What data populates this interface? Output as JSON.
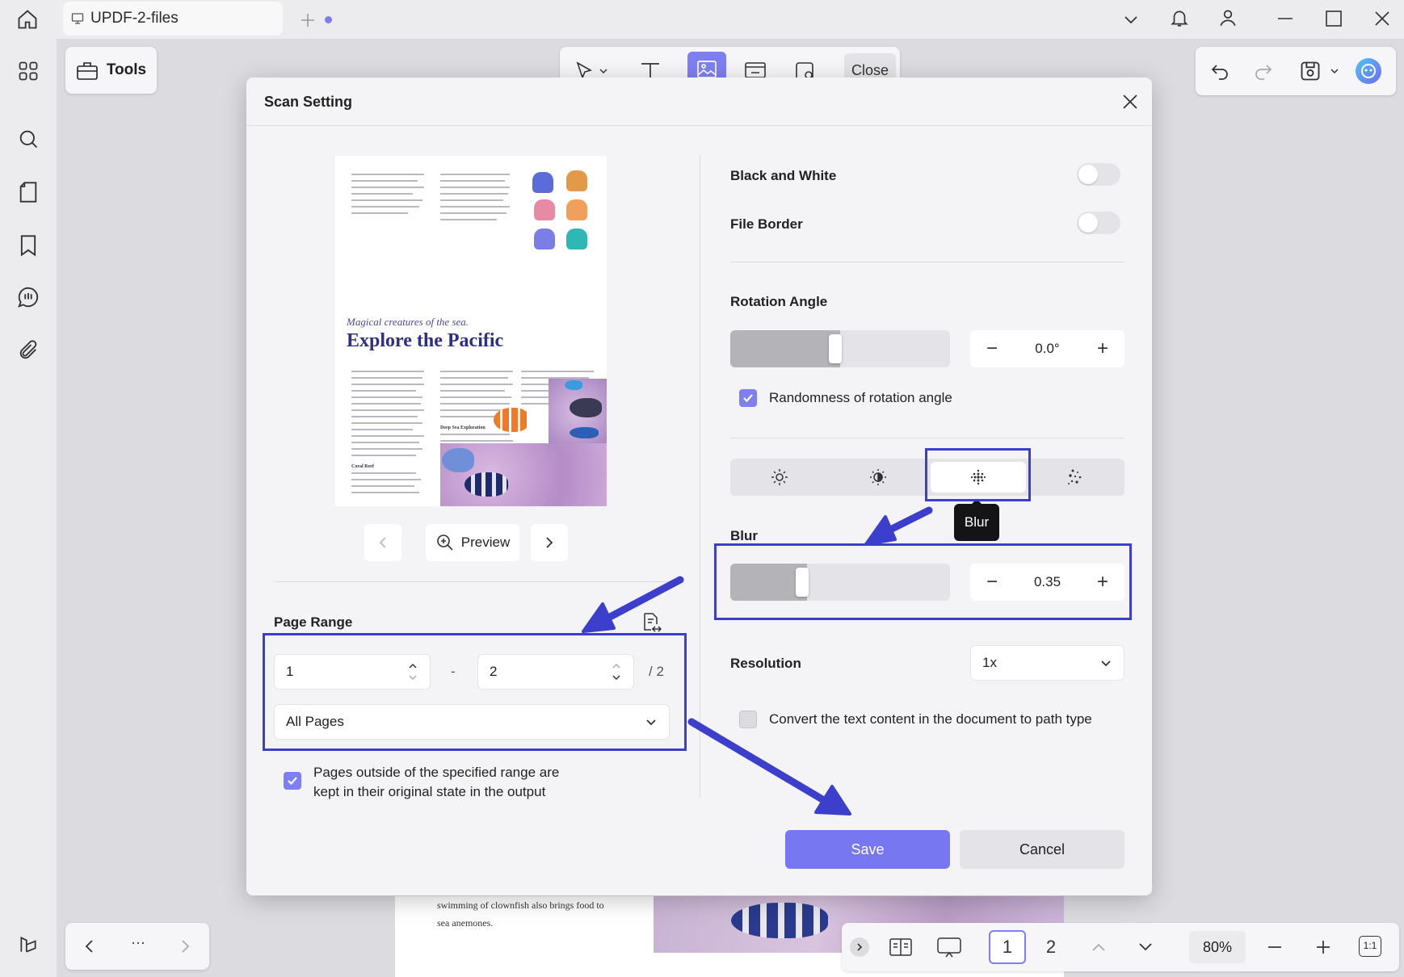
{
  "colors": {
    "accent": "#7e7ff3",
    "save_bg": "#7677f1",
    "annotation": "#3c3fcc",
    "canvas": "#dcdce0",
    "dialog_bg": "#f4f4f6"
  },
  "titlebar": {
    "tab_title": "UPDF-2-files",
    "icons": [
      "home-icon",
      "monitor-icon",
      "add-tab-icon",
      "dropdown-icon",
      "bell-icon",
      "user-icon",
      "minimize-icon",
      "maximize-icon",
      "close-icon"
    ]
  },
  "left_rail": {
    "icons": [
      "apps-icon",
      "search-icon",
      "page-icon",
      "bookmark-icon",
      "comment-icon",
      "attachment-icon",
      "layers-icon"
    ]
  },
  "toolbar": {
    "tools_label": "Tools",
    "close_label": "Close",
    "icons": [
      "select-icon",
      "text-icon",
      "image-icon",
      "link-icon",
      "stamp-icon"
    ],
    "right_icons": [
      "undo-icon",
      "redo-icon",
      "save-icon",
      "ai-assistant-icon"
    ]
  },
  "pdf_background": {
    "text_lines": [
      "swimming of clownfish also brings food to",
      "sea anemones."
    ]
  },
  "bottom_bar": {
    "pages": [
      "1",
      "2"
    ],
    "current_page": "1",
    "zoom": "80%",
    "actual_size_label": "1:1",
    "more_label": "···"
  },
  "dialog": {
    "title": "Scan Setting",
    "preview": {
      "subtitle": "Magical creatures of the sea.",
      "title": "Explore the Pacific",
      "heading_1": "Deep Sea Exploration",
      "heading_2": "Coral Reef",
      "preview_label": "Preview"
    },
    "page_range": {
      "label": "Page Range",
      "from": "1",
      "to": "2",
      "dash": "-",
      "total": "/ 2",
      "mode": "All Pages",
      "keep_original_checked": true,
      "keep_original_label_1": "Pages outside of the specified range are",
      "keep_original_label_2": "kept in their original state in the output"
    },
    "black_and_white": {
      "label": "Black and White",
      "on": false
    },
    "file_border": {
      "label": "File Border",
      "on": false
    },
    "rotation": {
      "label": "Rotation Angle",
      "value": "0.0°",
      "slider_fraction": 0.5,
      "randomness_checked": true,
      "randomness_label": "Randomness of rotation angle"
    },
    "effects": {
      "items": [
        "brightness-icon",
        "contrast-icon",
        "blur-icon",
        "noise-icon"
      ],
      "active": "blur-icon",
      "tooltip": "Blur"
    },
    "blur": {
      "label": "Blur",
      "value": "0.35",
      "slider_fraction": 0.35
    },
    "resolution": {
      "label": "Resolution",
      "value": "1x"
    },
    "convert_text": {
      "checked": false,
      "label": "Convert the text content in the document to path type"
    },
    "minus": "−",
    "plus": "+",
    "save_label": "Save",
    "cancel_label": "Cancel"
  }
}
